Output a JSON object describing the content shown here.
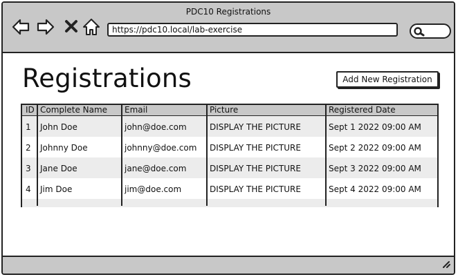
{
  "window": {
    "title": "PDC10 Registrations"
  },
  "browser": {
    "url": "https://pdc10.local/lab-exercise"
  },
  "page": {
    "title": "Registrations",
    "add_button": "Add New Registration"
  },
  "table": {
    "columns": [
      "ID",
      "Complete Name",
      "Email",
      "Picture",
      "Registered Date"
    ],
    "rows": [
      [
        "1",
        "John Doe",
        "john@doe.com",
        "DISPLAY THE PICTURE",
        "Sept 1 2022 09:00 AM"
      ],
      [
        "2",
        "Johnny Doe",
        "johnny@doe.com",
        "DISPLAY THE PICTURE",
        "Sept 2 2022 09:00 AM"
      ],
      [
        "3",
        "Jane Doe",
        "jane@doe.com",
        "DISPLAY THE PICTURE",
        "Sept 3 2022 09:00 AM"
      ],
      [
        "4",
        "Jim Doe",
        "jim@doe.com",
        "DISPLAY THE PICTURE",
        "Sept 4 2022 09:00 AM"
      ]
    ]
  },
  "icons": [
    "back-arrow-icon",
    "forward-arrow-icon",
    "close-icon",
    "home-icon",
    "search-icon",
    "resize-handle-icon"
  ]
}
